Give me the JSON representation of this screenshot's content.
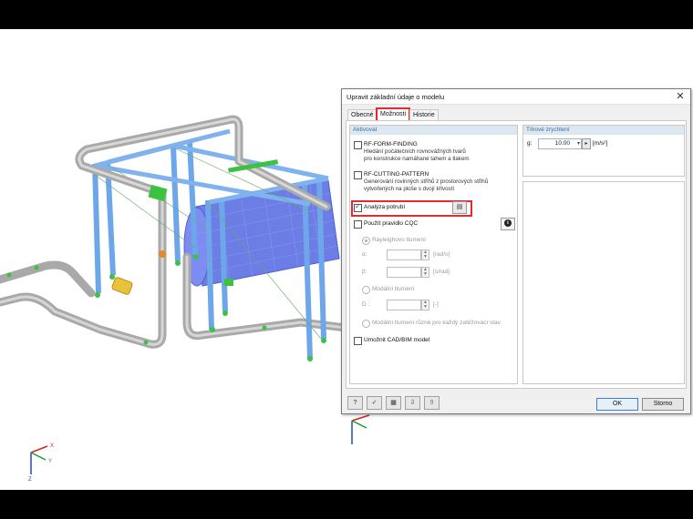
{
  "dialog": {
    "title": "Upravit základní údaje o modelu",
    "close_glyph": "✕",
    "tabs": [
      {
        "label": "Obecné",
        "active": false
      },
      {
        "label": "Možnosti",
        "active": true
      },
      {
        "label": "Historie",
        "active": false
      }
    ],
    "activate": {
      "header": "Aktivovat",
      "form_finding": {
        "label": "RF-FORM-FINDING",
        "desc1": "Hledání počátečních rovnovážných tvarů",
        "desc2": "pro konstrukce namáhané tahem a tlakem",
        "checked": false
      },
      "cutting_pattern": {
        "label": "RF-CUTTING-PATTERN",
        "desc1": "Generování rovinných střihů z prostorových střihů",
        "desc2": "vytvořených na ploše s dvojí křivostí",
        "checked": false
      },
      "pipe_analysis": {
        "label": "Analýza potrubí",
        "checked": true
      },
      "cqc": {
        "label": "Použít pravidlo CQC",
        "checked": false,
        "rayleigh": "Rayleighovo tlumení",
        "alpha_symbol": "α:",
        "alpha_unit": "[rad/s]",
        "beta_symbol": "β:",
        "beta_unit": "[s/rad]",
        "modal": "Modální tlumení",
        "d_symbol": "D :",
        "d_unit": "[-]",
        "modal_each": "Modální tlumení různé pro každý zatěžovací stav"
      },
      "cad_bim": {
        "label": "Umožnit CAD/BIM model",
        "checked": false
      }
    },
    "gravity": {
      "header": "Tíhové zrychlení",
      "symbol": "g:",
      "value": "10.00",
      "unit": "[m/s²]"
    },
    "buttons": {
      "ok": "OK",
      "cancel": "Storno"
    },
    "tools": [
      "?",
      "✓",
      "▦",
      "⇩",
      "⇧"
    ]
  },
  "viewport": {
    "axes": {
      "x": "X",
      "y": "Y",
      "z": "Z"
    },
    "colors": {
      "pipe": "#b9b9b9",
      "beam": "#7fb2ee",
      "tank": "#6c7de6",
      "support": "#3cc241",
      "highlight": "#e5292f"
    }
  }
}
